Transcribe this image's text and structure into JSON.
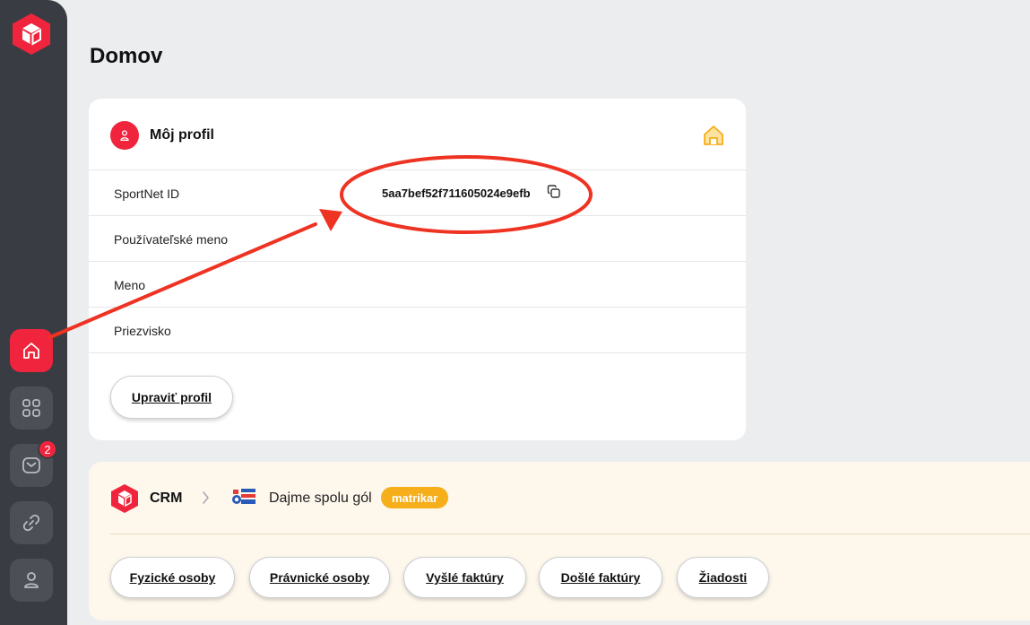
{
  "page": {
    "title": "Domov"
  },
  "sidebar": {
    "items": [
      {
        "icon": "home-icon",
        "active": true
      },
      {
        "icon": "apps-grid-icon",
        "active": false
      },
      {
        "icon": "mail-icon",
        "active": false,
        "badge": "2"
      },
      {
        "icon": "link-icon",
        "active": false
      },
      {
        "icon": "user-icon",
        "active": false
      }
    ]
  },
  "profile": {
    "title": "Môj profil",
    "rows": [
      {
        "label": "SportNet ID",
        "value": "5aa7bef52f711605024e9efb"
      },
      {
        "label": "Používateľské meno",
        "value": ""
      },
      {
        "label": "Meno",
        "value": ""
      },
      {
        "label": "Priezvisko",
        "value": ""
      }
    ],
    "edit_label": "Upraviť profil"
  },
  "crm": {
    "label": "CRM",
    "club_name": "Dajme spolu gól",
    "role": "matrikar",
    "buttons": [
      "Fyzické osoby",
      "Právnické osoby",
      "Vyšlé faktúry",
      "Došlé faktúry",
      "Žiadosti"
    ]
  },
  "colors": {
    "accent": "#f0253d",
    "sidebar": "#3a3c43",
    "tag": "#f6ae1a",
    "annotation": "#ee3322"
  }
}
